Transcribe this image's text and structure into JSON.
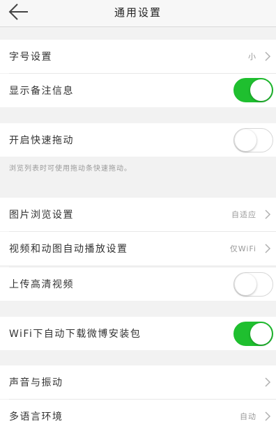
{
  "navbar": {
    "title": "通用设置",
    "back_icon": "back-arrow-icon"
  },
  "settings": {
    "font_size": {
      "label": "字号设置",
      "value": "小"
    },
    "show_remark": {
      "label": "显示备注信息",
      "on": true
    },
    "quick_drag": {
      "label": "开启快速拖动",
      "on": false,
      "hint": "浏览列表时可使用拖动条快速拖动。"
    },
    "image_browse": {
      "label": "图片浏览设置",
      "value": "自适应"
    },
    "autoplay": {
      "label": "视频和动图自动播放设置",
      "value": "仅WiFi"
    },
    "hd_upload": {
      "label": "上传高清视频",
      "on": false
    },
    "wifi_download": {
      "label": "WiFi下自动下载微博安装包",
      "on": true
    },
    "sound_vibration": {
      "label": "声音与振动"
    },
    "language": {
      "label": "多语言环境",
      "value": "自动"
    }
  },
  "colors": {
    "toggle_on": "#1fbf2f",
    "background": "#f2f2f2"
  }
}
